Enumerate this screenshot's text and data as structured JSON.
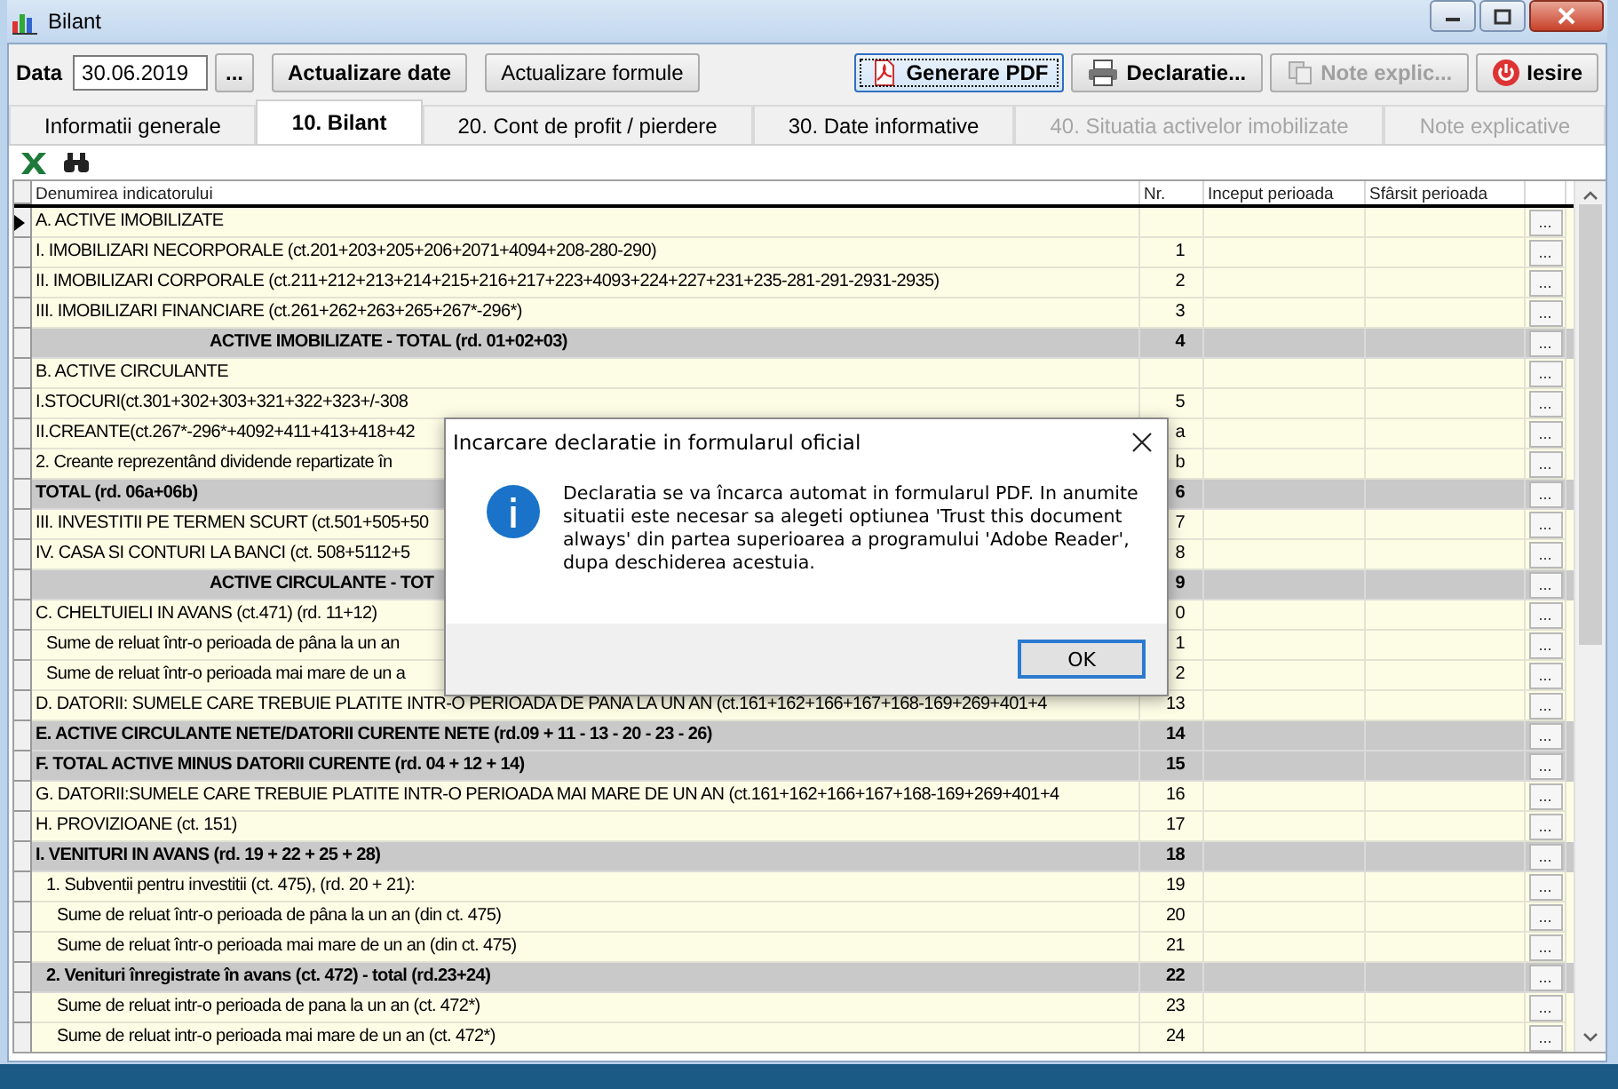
{
  "window": {
    "title": "Bilant"
  },
  "toolbar": {
    "date_label": "Data",
    "date_value": "30.06.2019",
    "date_picker": "...",
    "left_buttons": [
      {
        "label": "Actualizare date"
      },
      {
        "label": "Actualizare formule"
      }
    ],
    "right_buttons": [
      {
        "label": "Generare PDF",
        "focused": true,
        "disabled": false
      },
      {
        "label": "Declaratie...",
        "focused": false,
        "disabled": false
      },
      {
        "label": "Note explic...",
        "focused": false,
        "disabled": true
      },
      {
        "label": "Iesire",
        "focused": false,
        "disabled": false
      }
    ]
  },
  "tabs": [
    {
      "label": "Informatii generale",
      "selected": false,
      "disabled": false
    },
    {
      "label": "10. Bilant",
      "selected": true,
      "disabled": false
    },
    {
      "label": "20. Cont de profit / pierdere",
      "selected": false,
      "disabled": false
    },
    {
      "label": "30. Date informative",
      "selected": false,
      "disabled": false
    },
    {
      "label": "40. Situatia activelor imobilizate",
      "selected": false,
      "disabled": true
    },
    {
      "label": "Note explicative",
      "selected": false,
      "disabled": true
    }
  ],
  "table": {
    "columns": [
      "Denumirea indicatorului",
      "Nr.",
      "Inceput perioada",
      "Sfârsit perioada"
    ],
    "row_button": "...",
    "rows": [
      {
        "kind": "item",
        "label": "A. ACTIVE IMOBILIZATE",
        "nr": "",
        "selected": true
      },
      {
        "kind": "item",
        "label": "I. IMOBILIZARI NECORPORALE (ct.201+203+205+206+2071+4094+208-280-290)",
        "nr": "1",
        "selected": false
      },
      {
        "kind": "item",
        "label": "II. IMOBILIZARI CORPORALE (ct.211+212+213+214+215+216+217+223+4093+224+227+231+235-281-291-2931-2935)",
        "nr": "2",
        "selected": false
      },
      {
        "kind": "item",
        "label": "III. IMOBILIZARI FINANCIARE (ct.261+262+263+265+267*-296*)",
        "nr": "3",
        "selected": false
      },
      {
        "kind": "heading",
        "label": "ACTIVE IMOBILIZATE - TOTAL (rd. 01+02+03)",
        "nr": "4",
        "selected": false
      },
      {
        "kind": "item",
        "label": "B. ACTIVE CIRCULANTE",
        "nr": "",
        "selected": false
      },
      {
        "kind": "item",
        "label": "I.STOCURI(ct.301+302+303+321+322+323+/-308",
        "nr": "5",
        "selected": false
      },
      {
        "kind": "item",
        "label": "II.CREANTE(ct.267*-296*+4092+411+413+418+42",
        "nr": "a",
        "selected": false
      },
      {
        "kind": "item",
        "label": "2. Creante reprezentând dividende repartizate în",
        "nr": "b",
        "selected": false
      },
      {
        "kind": "total",
        "label": "TOTAL (rd. 06a+06b)",
        "nr": "6",
        "selected": false
      },
      {
        "kind": "item",
        "label": "III. INVESTITII PE TERMEN SCURT (ct.501+505+50",
        "nr": "7",
        "selected": false
      },
      {
        "kind": "item",
        "label": "IV. CASA SI CONTURI LA BANCI (ct. 508+5112+5",
        "nr": "8",
        "selected": false
      },
      {
        "kind": "heading",
        "label": "ACTIVE CIRCULANTE - TOT",
        "nr": "9",
        "selected": false
      },
      {
        "kind": "item",
        "label": "C. CHELTUIELI IN AVANS (ct.471) (rd. 11+12)",
        "nr": "0",
        "selected": false
      },
      {
        "kind": "sub",
        "label": "Sume de reluat într-o perioada de pâna la un an",
        "nr": "1",
        "selected": false
      },
      {
        "kind": "sub",
        "label": "Sume de reluat într-o perioada mai mare de un a",
        "nr": "2",
        "selected": false
      },
      {
        "kind": "item",
        "label": "D. DATORII: SUMELE CARE TREBUIE PLATITE INTR-O PERIOADA DE PANA LA UN AN (ct.161+162+166+167+168-169+269+401+4",
        "nr": "13",
        "selected": false
      },
      {
        "kind": "total",
        "label": "E. ACTIVE CIRCULANTE NETE/DATORII CURENTE NETE (rd.09 + 11 - 13 - 20 - 23 - 26)",
        "nr": "14",
        "selected": false
      },
      {
        "kind": "total",
        "label": "F. TOTAL ACTIVE MINUS DATORII CURENTE (rd. 04 + 12 + 14)",
        "nr": "15",
        "selected": false
      },
      {
        "kind": "item",
        "label": "G. DATORII:SUMELE CARE TREBUIE PLATITE INTR-O PERIOADA MAI MARE DE UN AN (ct.161+162+166+167+168-169+269+401+4",
        "nr": "16",
        "selected": false
      },
      {
        "kind": "item",
        "label": "H. PROVIZIOANE (ct. 151)",
        "nr": "17",
        "selected": false
      },
      {
        "kind": "total",
        "label": "I. VENITURI IN AVANS (rd. 19 + 22 + 25 + 28)",
        "nr": "18",
        "selected": false
      },
      {
        "kind": "sub",
        "label": "1. Subventii pentru investitii (ct. 475), (rd. 20 + 21):",
        "nr": "19",
        "selected": false
      },
      {
        "kind": "subsub",
        "label": "Sume de reluat într-o perioada de pâna la un an (din ct. 475)",
        "nr": "20",
        "selected": false
      },
      {
        "kind": "subsub",
        "label": "Sume de reluat într-o perioada mai mare de un an (din ct. 475)",
        "nr": "21",
        "selected": false
      },
      {
        "kind": "subtotal",
        "label": "2. Venituri înregistrate în avans (ct. 472) - total (rd.23+24)",
        "nr": "22",
        "selected": false
      },
      {
        "kind": "subsub",
        "label": "Sume de reluat intr-o perioada de pana la un an (ct. 472*)",
        "nr": "23",
        "selected": false
      },
      {
        "kind": "subsub",
        "label": "Sume de reluat intr-o perioada mai mare de un an (ct. 472*)",
        "nr": "24",
        "selected": false
      }
    ]
  },
  "dialog": {
    "title": "Incarcare declaratie in formularul oficial",
    "message": "Declaratia se va încarca automat in formularul PDF. In anumite situatii este necesar sa alegeti optiunea 'Trust this document always' din partea superioarea a programului 'Adobe Reader', dupa deschiderea acestuia.",
    "button": "OK"
  }
}
